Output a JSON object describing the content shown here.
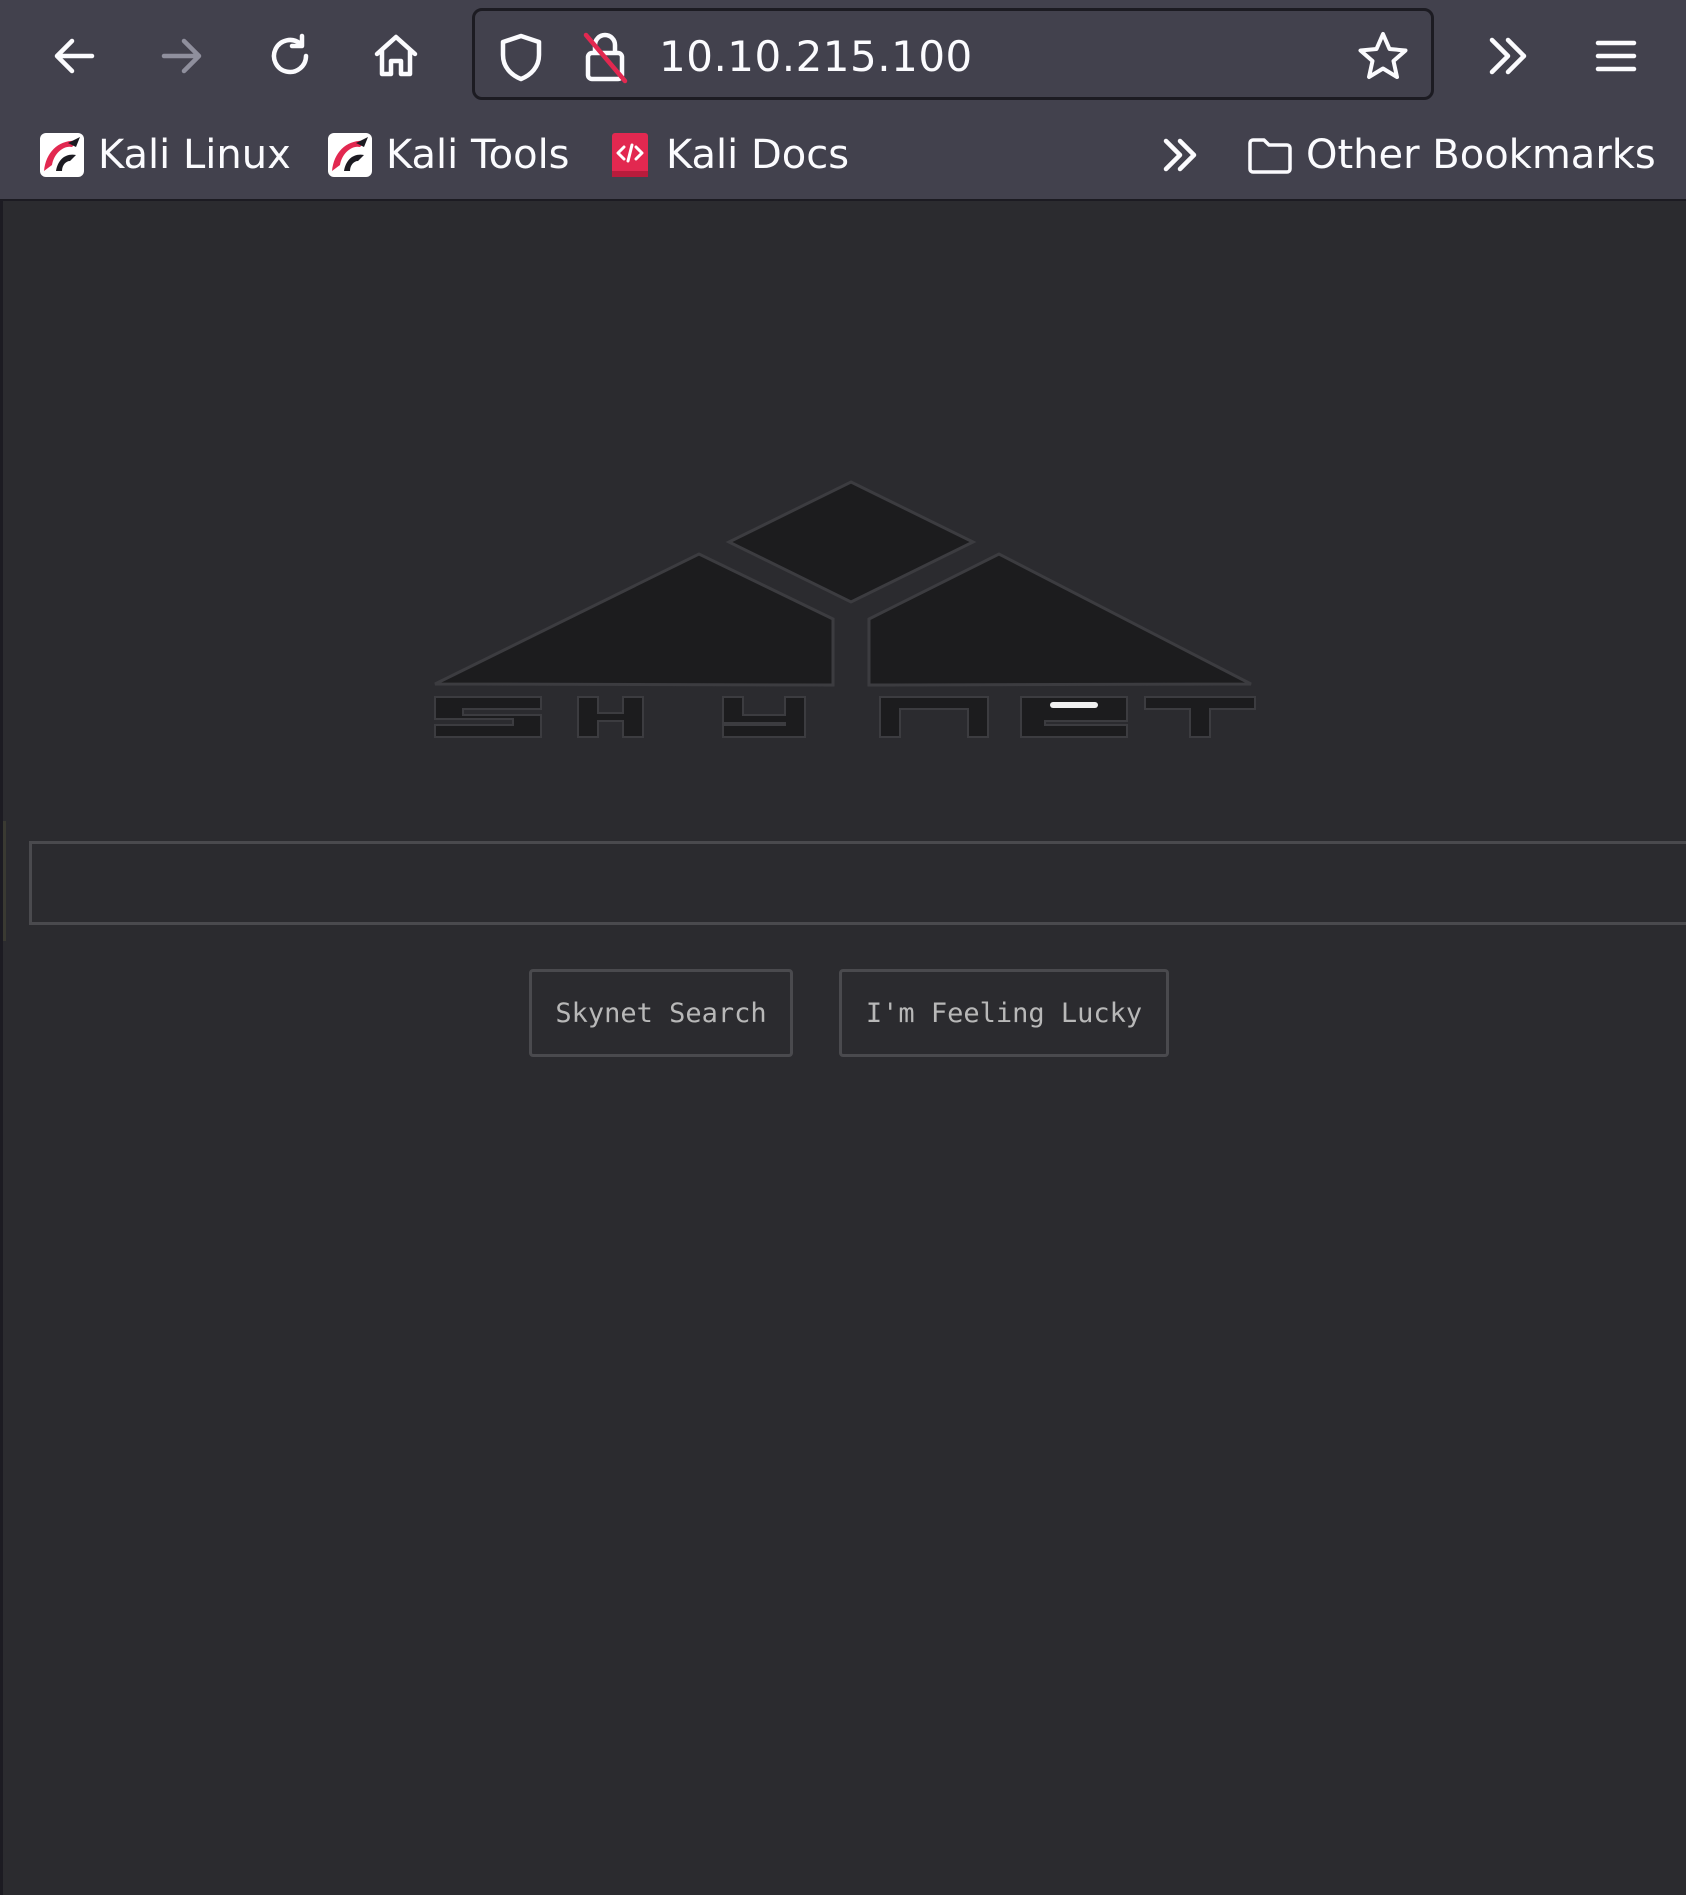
{
  "browser": {
    "url": "10.10.215.100",
    "bookmarks": [
      {
        "label": "Kali Linux",
        "icon": "kali-dragon-icon"
      },
      {
        "label": "Kali Tools",
        "icon": "kali-dragon-icon"
      },
      {
        "label": "Kali Docs",
        "icon": "kali-docs-icon"
      }
    ],
    "other_bookmarks_label": "Other Bookmarks",
    "icons": {
      "back": "back-arrow-icon",
      "forward": "forward-arrow-icon",
      "reload": "reload-icon",
      "home": "home-icon",
      "shield": "tracking-protection-shield-icon",
      "lock": "insecure-lock-icon",
      "star": "bookmark-star-icon",
      "overflow": "chevrons-right-icon",
      "menu": "hamburger-menu-icon"
    },
    "colors": {
      "toolbar": "#42414d",
      "text": "#fbfbfe",
      "accent_red": "#e22850"
    }
  },
  "page": {
    "logo_alt": "skynet",
    "search": {
      "value": "",
      "placeholder": ""
    },
    "buttons": {
      "search_label": "Skynet Search",
      "lucky_label": "I'm Feeling Lucky"
    },
    "colors": {
      "background": "#2b2b2f",
      "button_text": "#b8b8b8",
      "border": "#4a4a4e"
    }
  }
}
